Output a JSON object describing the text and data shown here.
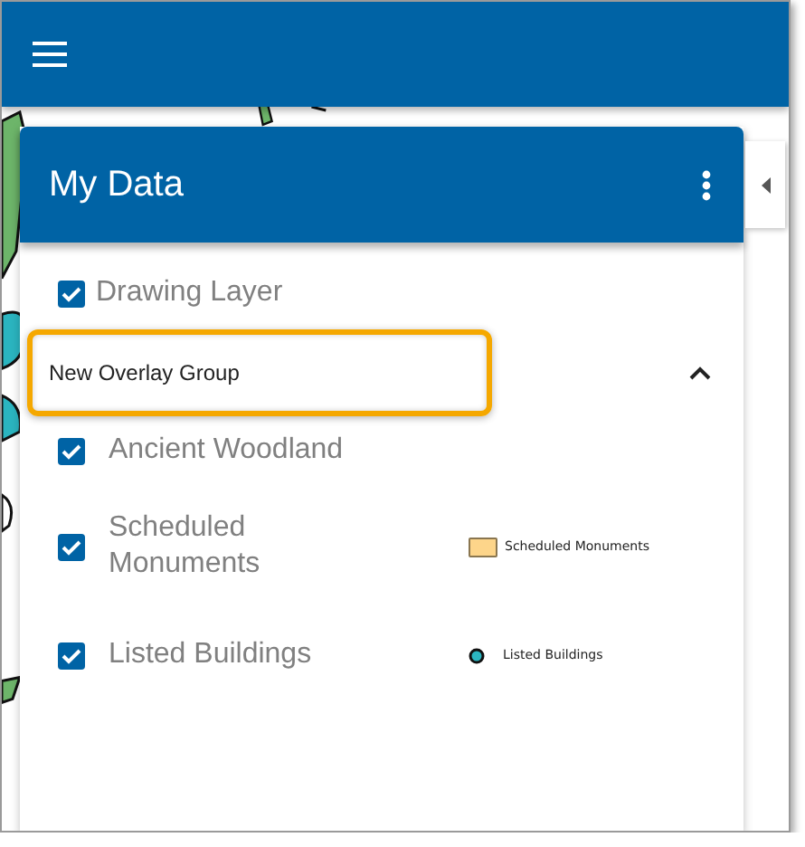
{
  "panel": {
    "title": "My Data"
  },
  "layers": [
    {
      "label": "Drawing Layer",
      "checked": true
    }
  ],
  "group": {
    "name": "New Overlay Group",
    "expanded": true,
    "highlighted": true,
    "layers": [
      {
        "label": "Ancient Woodland",
        "checked": true
      },
      {
        "label": "Scheduled Monuments",
        "checked": true,
        "legend": {
          "kind": "swatch",
          "label": "Scheduled Monuments",
          "color": "#fdd58a"
        }
      },
      {
        "label": "Listed Buildings",
        "checked": true,
        "legend": {
          "kind": "point",
          "label": "Listed Buildings",
          "color": "#2bb5c0"
        }
      }
    ]
  }
}
